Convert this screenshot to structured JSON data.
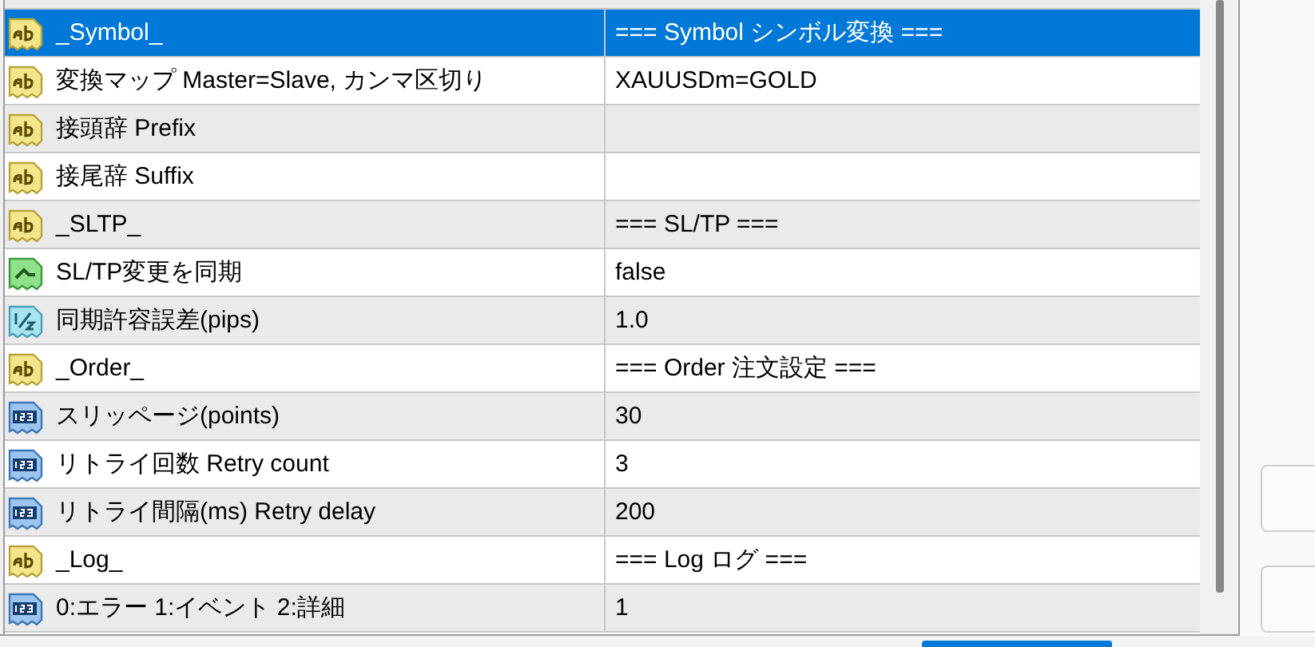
{
  "parameters": [
    {
      "kind": "string",
      "name": "_Symbol_",
      "value": "=== Symbol シンボル変換 ===",
      "selected": true
    },
    {
      "kind": "string",
      "name": "変換マップ Master=Slave, カンマ区切り",
      "value": "XAUUSDm=GOLD",
      "selected": false
    },
    {
      "kind": "string",
      "name": "接頭辞 Prefix",
      "selected": false
    },
    {
      "kind": "string",
      "name": "接尾辞 Suffix",
      "selected": false
    },
    {
      "kind": "string",
      "name": "_SLTP_",
      "value": "=== SL/TP ===",
      "selected": false
    },
    {
      "kind": "bool",
      "name": "SL/TP変更を同期",
      "value": "false",
      "selected": false
    },
    {
      "kind": "double",
      "name": "同期許容誤差(pips)",
      "value": "1.0",
      "selected": false
    },
    {
      "kind": "string",
      "name": "_Order_",
      "value": "=== Order 注文設定 ===",
      "selected": false
    },
    {
      "kind": "int",
      "name": "スリッページ(points)",
      "value": "30",
      "selected": false
    },
    {
      "kind": "int",
      "name": "リトライ回数 Retry count",
      "value": "3",
      "selected": false
    },
    {
      "kind": "int",
      "name": "リトライ間隔(ms) Retry delay",
      "value": "200",
      "selected": false
    },
    {
      "kind": "string",
      "name": "_Log_",
      "value": "=== Log ログ ===",
      "selected": false
    },
    {
      "kind": "int",
      "name": "0:エラー 1:イベント 2:詳細",
      "value": "1",
      "selected": false
    }
  ]
}
